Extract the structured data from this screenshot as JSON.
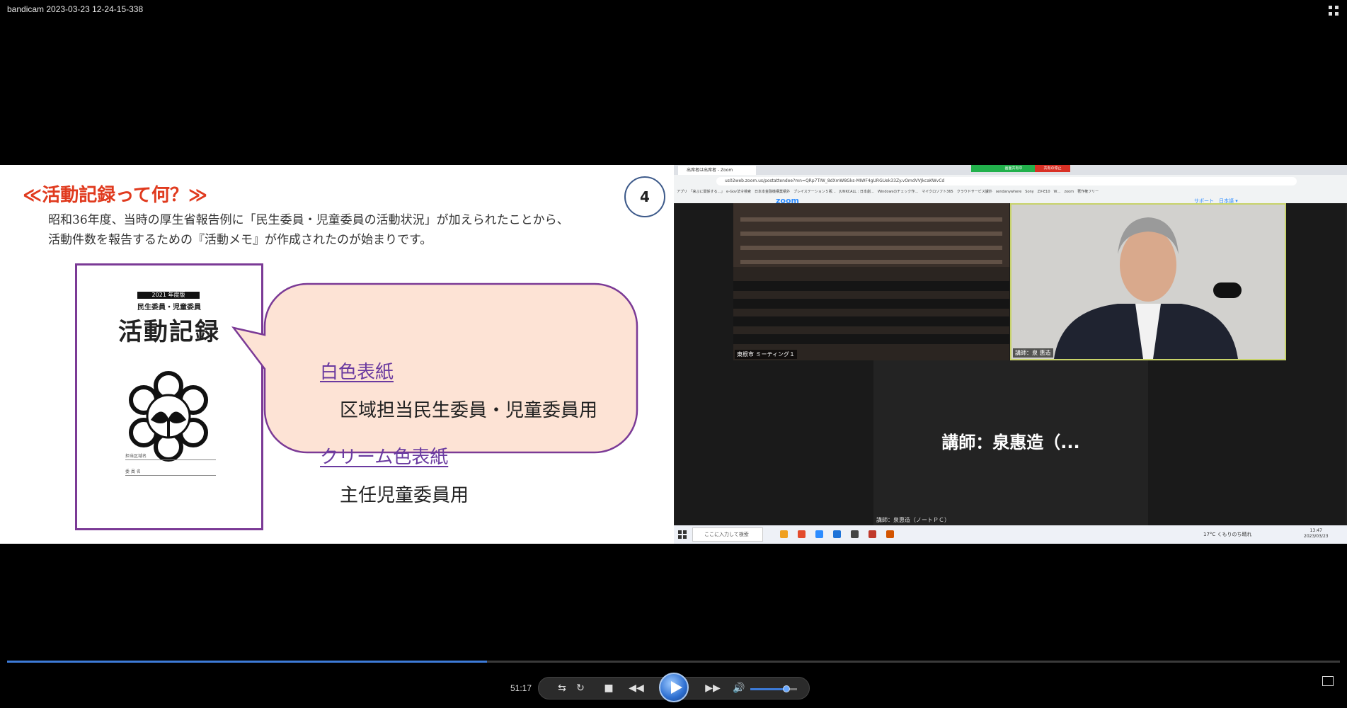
{
  "window": {
    "title": "bandicam 2023-03-23 12-24-15-338",
    "fullscreen_icon": "fullscreen-toggle-icon"
  },
  "slide": {
    "title": "≪活動記録って何？≫",
    "page_number": "4",
    "intro_line1": "昭和36年度、当時の厚生省報告例に「民生委員・児童委員の活動状況」が加えられたことから、",
    "intro_line2": "活動件数を報告するための『活動メモ』が作成されたのが始まりです。",
    "booklet": {
      "year": "2021 年度版",
      "subtitle": "民生委員・児童委員",
      "title": "活動記録",
      "field1": "担当区域名",
      "field2": "委 員 名"
    },
    "bubble": {
      "label1": "白色表紙",
      "desc1": "区域担当民生委員・児童委員用",
      "label2": "クリーム色表紙",
      "desc2": "主任児童委員用",
      "fill_color": "#fde3d5",
      "border_color": "#7b3a96"
    },
    "accent_title_color": "#e03a1e"
  },
  "zoom": {
    "tab_title": "出席者は出席者 - Zoom",
    "share_status": "画面共有中",
    "stop_share": "共有の停止",
    "address": "us02web.zoom.us/postattendee?mn=QRp7TIW_8dXmW8Gks-MIWF4gURGUek33Zy.vOmdVVJkcaKWvCd",
    "bookmarks": "アプリ　「来ぶに関係する…」　e-Gov法令検索　日本本金融機構業積外　プレイステーション５販…　JUNKCALL : 日本劇…　Windowsのチェック作…　マイクロソフト365　クラウドサービス課外　sendanywhere　Sony　ZV-E10　W…　zoom　著作権フリー",
    "logo": "zoom",
    "support": "サポート　日本語 ▾",
    "audience_label": "東根市 ミーティング１",
    "speaker_label": "講師：泉 惠造",
    "big_name": "講師：泉惠造（...",
    "lower_label": "講師：泉惠造（ノートＰＣ）",
    "search_placeholder": "ここに入力して検索",
    "weather": "17°C くもりのち晴れ",
    "clock_time": "13:47",
    "clock_date": "2023/03/23"
  },
  "player": {
    "time": "51:17",
    "progress": 0.36,
    "volume": 0.78,
    "buttons": [
      "repeat-ab-icon",
      "repeat-icon",
      "stop-icon",
      "rewind-icon",
      "play-icon",
      "fast-forward-icon",
      "volume-icon",
      "mini-player-icon"
    ]
  }
}
